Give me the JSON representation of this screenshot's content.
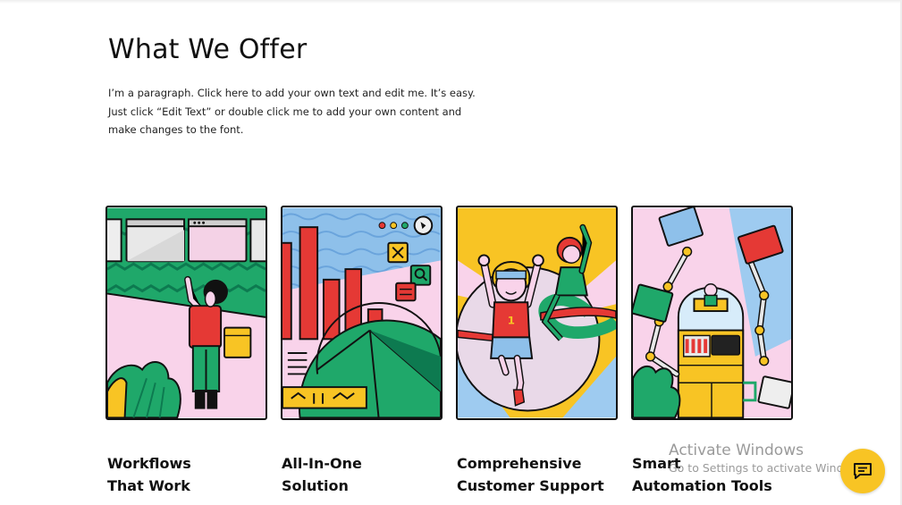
{
  "page": {
    "title": "What We Offer",
    "paragraph_lines": [
      "I’m a paragraph. Click here to add your own text and edit me. It’s easy.",
      "Just click “Edit Text” or double click me to add your own content and",
      "make changes to the font."
    ]
  },
  "offers": [
    {
      "line1": "Workflows",
      "line2": "That Work",
      "illustration": "person-pointing-at-browser-windows"
    },
    {
      "line1": "All-In-One",
      "line2": "Solution",
      "illustration": "bar-chart-and-pie-chart"
    },
    {
      "line1": "Comprehensive",
      "line2": "Customer Support",
      "illustration": "runner-crossing-finish-line"
    },
    {
      "line1": "Smart",
      "line2": "Automation Tools",
      "illustration": "robot-arms-holding-windows"
    }
  ],
  "os_watermark": {
    "title": "Activate Windows",
    "subtitle": "Go to Settings to activate Windows."
  },
  "chat_widget": {
    "icon": "chat-icon",
    "color": "#f8c424"
  },
  "colors": {
    "green": "#1fa86a",
    "dark_green": "#0d7a50",
    "pink": "#f8d4ea",
    "red": "#e53935",
    "yellow": "#f8c424",
    "blue": "#7fb2e8",
    "light_blue": "#9ecbf0",
    "black": "#111111"
  }
}
